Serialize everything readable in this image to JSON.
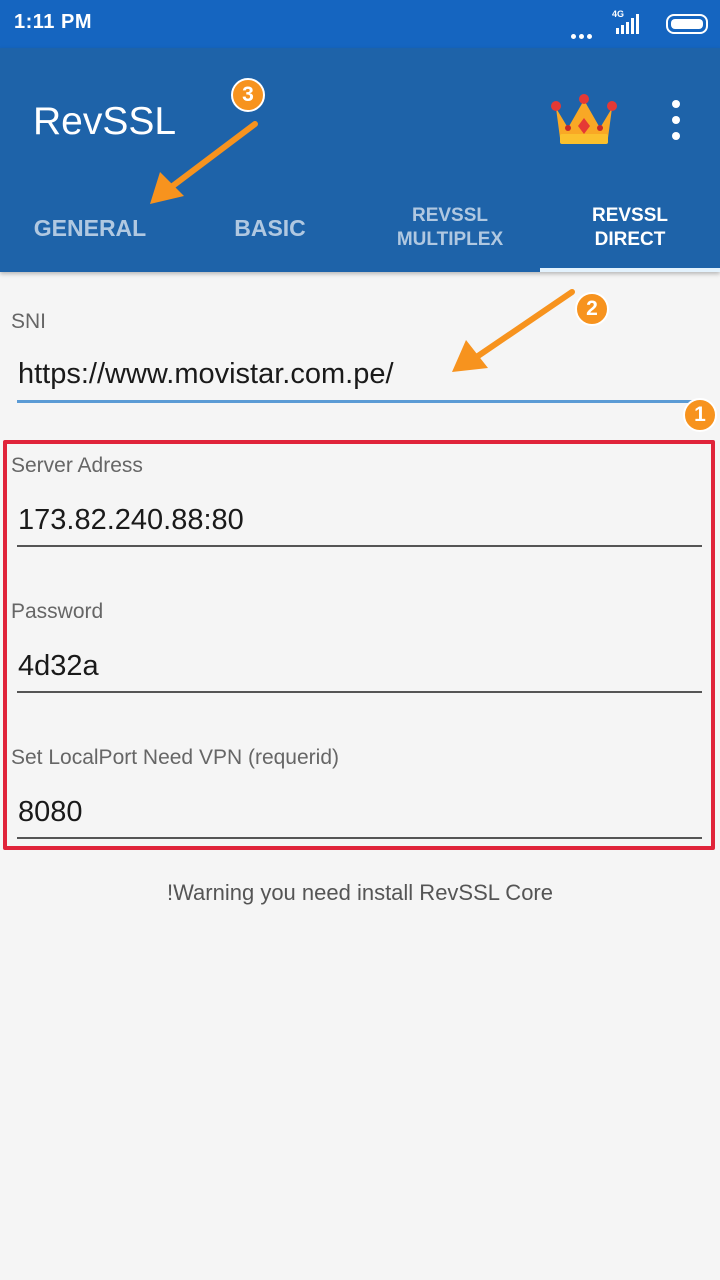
{
  "status": {
    "time": "1:11 PM",
    "network": "4G"
  },
  "app": {
    "title": "RevSSL"
  },
  "tabs": [
    {
      "label": "GENERAL",
      "active": false
    },
    {
      "label": "BASIC",
      "active": false
    },
    {
      "label": "REVSSL MULTIPLEX",
      "active": false
    },
    {
      "label": "REVSSL DIRECT",
      "active": true
    }
  ],
  "form": {
    "sni": {
      "label": "SNI",
      "value": "https://www.movistar.com.pe/"
    },
    "server": {
      "label": "Server Adress",
      "value": "173.82.240.88:80"
    },
    "password": {
      "label": "Password",
      "value": "4d32a"
    },
    "local_port": {
      "label": "Set LocalPort Need VPN (requerid)",
      "value": "8080"
    }
  },
  "warning": "!Warning you need install RevSSL Core",
  "annotations": {
    "badge_1": "1",
    "badge_2": "2",
    "badge_3": "3"
  },
  "colors": {
    "app_bar": "#1e63a9",
    "status_bar": "#1565c0",
    "highlight": "#e0243a",
    "annotation": "#f7931e"
  },
  "icons": [
    "crown-icon",
    "more-vert-icon",
    "signal-icon",
    "battery-icon"
  ]
}
